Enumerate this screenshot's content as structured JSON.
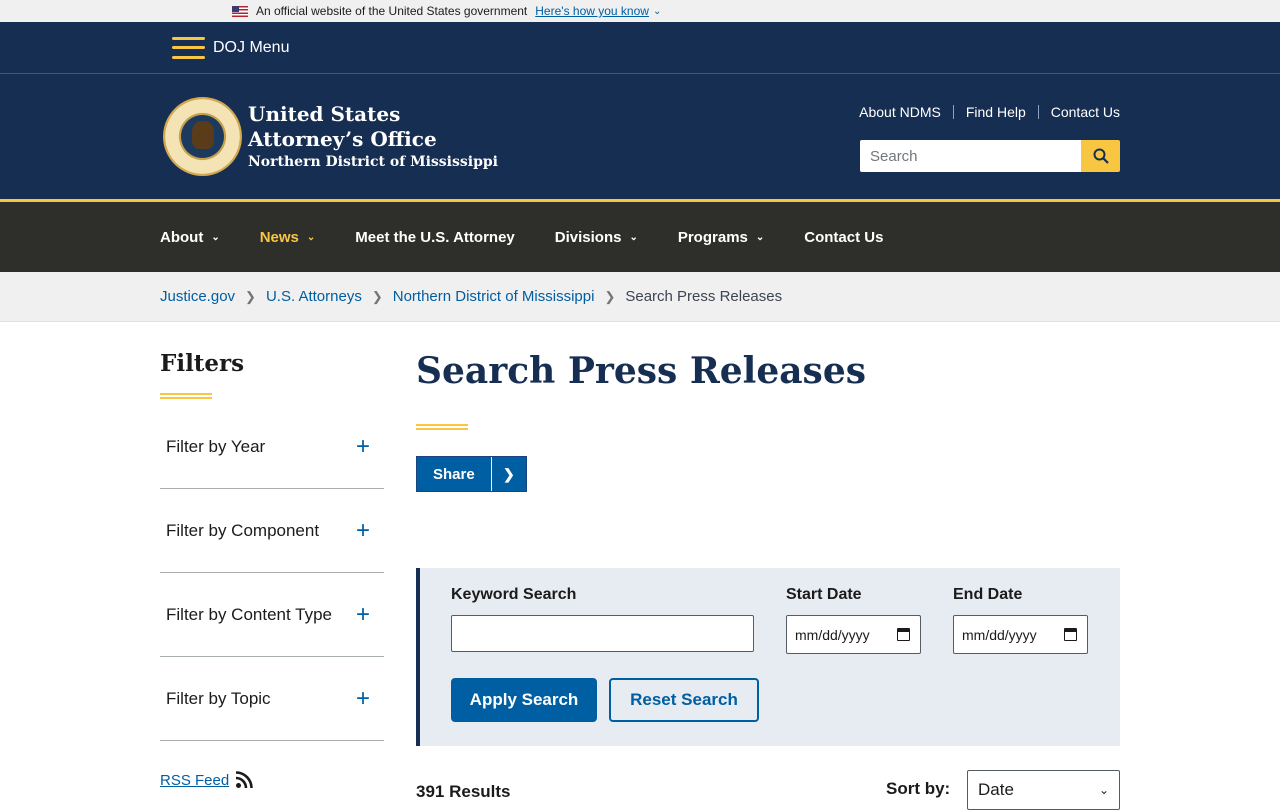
{
  "gov_banner": {
    "text": "An official website of the United States government",
    "link": "Here's how you know"
  },
  "doj_menu": {
    "label": "DOJ Menu"
  },
  "header": {
    "title_line1": "United States",
    "title_line2": "Attorney’s Office",
    "subtitle": "Northern District of Mississippi",
    "util_links": [
      "About NDMS",
      "Find Help",
      "Contact Us"
    ],
    "search_placeholder": "Search"
  },
  "nav": {
    "items": [
      {
        "label": "About",
        "has_dropdown": true,
        "active": false
      },
      {
        "label": "News",
        "has_dropdown": true,
        "active": true
      },
      {
        "label": "Meet the U.S. Attorney",
        "has_dropdown": false,
        "active": false
      },
      {
        "label": "Divisions",
        "has_dropdown": true,
        "active": false
      },
      {
        "label": "Programs",
        "has_dropdown": true,
        "active": false
      },
      {
        "label": "Contact Us",
        "has_dropdown": false,
        "active": false
      }
    ]
  },
  "breadcrumb": {
    "items": [
      "Justice.gov",
      "U.S. Attorneys",
      "Northern District of Mississippi"
    ],
    "current": "Search Press Releases"
  },
  "sidebar": {
    "title": "Filters",
    "filters": [
      "Filter by Year",
      "Filter by Component",
      "Filter by Content Type",
      "Filter by Topic"
    ],
    "rss_label": "RSS Feed"
  },
  "main": {
    "title": "Search Press Releases",
    "share_label": "Share",
    "search": {
      "keyword_label": "Keyword Search",
      "start_label": "Start Date",
      "end_label": "End Date",
      "date_placeholder": "mm/dd/yyyy",
      "apply_label": "Apply Search",
      "reset_label": "Reset Search"
    },
    "results_count": "391 Results",
    "sort_label": "Sort by:",
    "sort_value": "Date"
  },
  "colors": {
    "navy": "#162e51",
    "gold": "#f9c642",
    "link_blue": "#005ea2",
    "nav_bg": "#2e2e2a"
  }
}
